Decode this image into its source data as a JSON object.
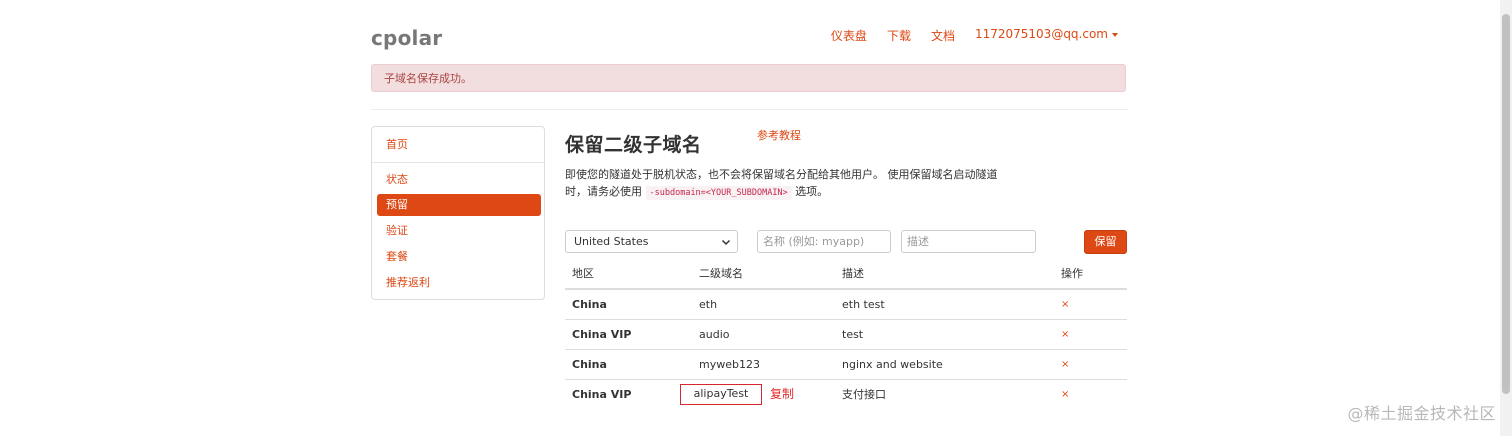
{
  "brand": "cpolar",
  "nav": {
    "dashboard": "仪表盘",
    "download": "下载",
    "docs": "文档",
    "user": "1172075103@qq.com"
  },
  "alert": "子域名保存成功。",
  "sidebar": {
    "items": [
      {
        "label": "首页"
      },
      {
        "label": "状态"
      },
      {
        "label": "预留",
        "active": true
      },
      {
        "label": "验证"
      },
      {
        "label": "套餐"
      },
      {
        "label": "推荐返利"
      }
    ]
  },
  "main": {
    "title": "保留二级子域名",
    "ref_link": "参考教程",
    "desc_part1": "即使您的隧道处于脱机状态，也不会将保留域名分配给其他用户。 使用保留域名启动隧道时，请务必使用",
    "desc_code": "-subdomain=<YOUR_SUBDOMAIN>",
    "desc_part2": "选项。"
  },
  "form": {
    "region_selected": "United States",
    "name_placeholder": "名称 (例如: myapp)",
    "desc_placeholder": "描述",
    "save_label": "保留"
  },
  "table": {
    "headers": [
      "地区",
      "二级域名",
      "描述",
      "操作"
    ],
    "rows": [
      {
        "region": "China",
        "subdomain": "eth",
        "description": "eth test",
        "action": "×"
      },
      {
        "region": "China VIP",
        "subdomain": "audio",
        "description": "test",
        "action": "×"
      },
      {
        "region": "China",
        "subdomain": "myweb123",
        "description": "nginx and website",
        "action": "×"
      },
      {
        "region": "China VIP",
        "subdomain": "alipayTest",
        "description": "支付接口",
        "action": "×"
      }
    ],
    "copy_label": "复制"
  },
  "watermark": "@稀土掘金技术社区",
  "colors": {
    "accent": "#dd4814",
    "alert_bg": "#f2dede",
    "alert_text": "#a94442",
    "highlight": "#d9262e"
  }
}
